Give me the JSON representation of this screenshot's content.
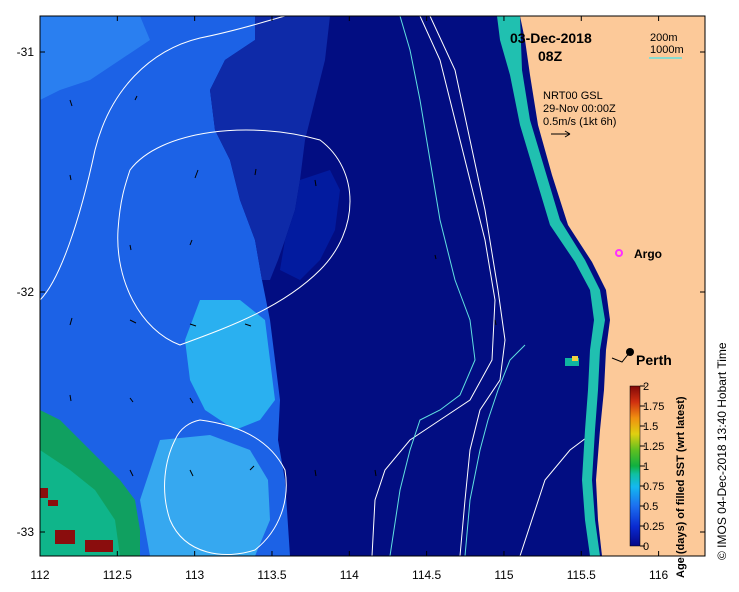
{
  "map": {
    "lon_range": [
      112,
      116.3
    ],
    "lat_range": [
      -33.1,
      -30.85
    ],
    "x_ticks": [
      "112",
      "112.5",
      "113",
      "113.5",
      "114",
      "114.5",
      "115",
      "115.5",
      "116"
    ],
    "y_ticks": [
      "-31",
      "-32",
      "-33"
    ],
    "date": "03-Dec-2018",
    "time": "08Z",
    "isobaths": {
      "shallow": "200m",
      "deep": "1000m"
    },
    "current_source": "NRT00 GSL",
    "current_date": "29-Nov 00:00Z",
    "current_scale": "0.5m/s (1kt 6h)",
    "places": {
      "argo": "Argo",
      "perth": "Perth"
    },
    "colorbar": {
      "title": "Age (days) of filled SST (wrt latest)",
      "ticks": [
        "0",
        "0.25",
        "0.5",
        "0.75",
        "1",
        "1.25",
        "1.5",
        "1.75",
        "2"
      ]
    },
    "credit": "© IMOS 04-Dec-2018 13:40 Hobart Time",
    "colors": {
      "land": "#fcc999",
      "navy": "#020d82",
      "dark_blue": "#021b9f",
      "mid_blue": "#1c3fd4",
      "sky_blue": "#2a7ff0",
      "cyan": "#1cb0f0",
      "teal": "#0fb5a0",
      "green": "#10a040",
      "dark_red": "#8a0d0d",
      "contour": "#ffffff",
      "isobath_shallow": "#ffffff",
      "isobath_deep": "#60e0e0",
      "argo_marker": "#ff30ff"
    }
  }
}
